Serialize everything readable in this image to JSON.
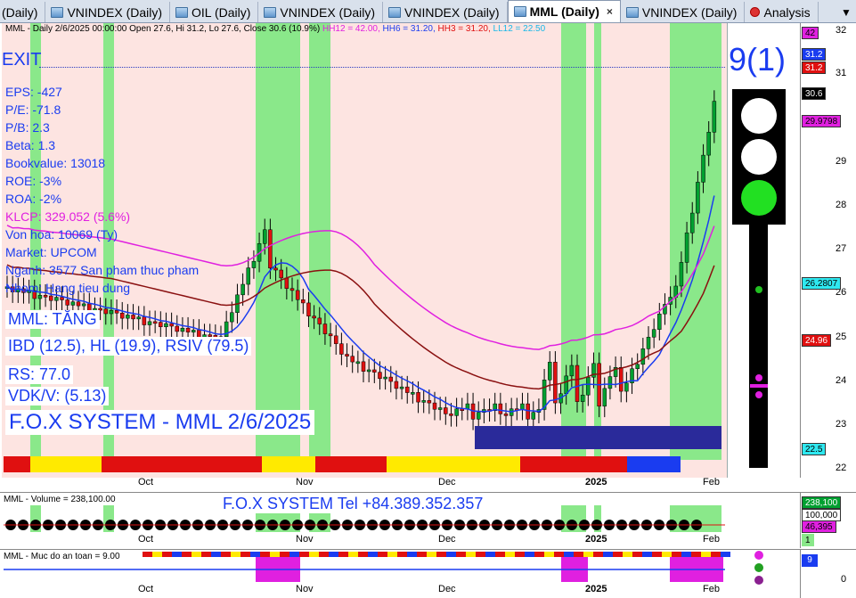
{
  "tabs": [
    {
      "label": "(Daily)",
      "active": false,
      "icon": "none"
    },
    {
      "label": "VNINDEX (Daily)",
      "active": false,
      "icon": "chart-icon"
    },
    {
      "label": "OIL (Daily)",
      "active": false,
      "icon": "chart-icon"
    },
    {
      "label": "VNINDEX (Daily)",
      "active": false,
      "icon": "chart-icon"
    },
    {
      "label": "VNINDEX (Daily)",
      "active": false,
      "icon": "chart-icon"
    },
    {
      "label": "MML (Daily)",
      "active": true,
      "icon": "chart-icon"
    },
    {
      "label": "VNINDEX (Daily)",
      "active": false,
      "icon": "chart-icon"
    },
    {
      "label": "Analysis",
      "active": false,
      "icon": "analysis-icon"
    }
  ],
  "tab_close": "×",
  "tab_scroll": "▼",
  "header": {
    "main": "MML - Daily 2/6/2025 00:00:00 Open 27.6, Hi 31.2, Lo 27.6, Close 30.6 (10.9%)",
    "hh12": "HH12 = 42.00,",
    "hh6": "HH6 = 31.20,",
    "hh3": "HH3 = 31.20,",
    "ll12": "LL12 = 22.50"
  },
  "exit_label": "EXIT",
  "fundamentals": {
    "eps": "EPS: -427",
    "pe": "P/E: -71.8",
    "pb": "P/B: 2.3",
    "beta": "Beta: 1.3",
    "bookvalue": "Bookvalue: 13018",
    "roe": "ROE: -3%",
    "roa": "ROA: -2%",
    "klcp": "KLCP: 329.052 (5.6%)",
    "vonhoa": "Von hoa: 10069 (Ty)",
    "market": "Market: UPCOM",
    "nganh": "Nganh: 3577 San pham thuc pham",
    "nhom": "Nhom: Hang tieu dung"
  },
  "trend": {
    "status": "MML: TĂNG",
    "ibd": "IBD (12.5), HL (19.9), RSIV (79.5)",
    "rs": "RS: 77.0",
    "vdk": "VDK/V:  (5.13)"
  },
  "system_title": "F.O.X SYSTEM - MML 2/6/2025",
  "signal": {
    "title": "9(1)",
    "lights": [
      "white",
      "white",
      "green"
    ]
  },
  "price_axis": {
    "ticks": [
      "32",
      "31",
      "29",
      "28",
      "27",
      "26",
      "25",
      "24",
      "23",
      "22"
    ],
    "tags": [
      {
        "text": "42",
        "bg": "#e020e0",
        "color": "#000"
      },
      {
        "text": "31.2",
        "bg": "#1a3cf0",
        "color": "#fff"
      },
      {
        "text": "31.2",
        "bg": "#e01010",
        "color": "#fff"
      },
      {
        "text": "30.6",
        "bg": "#000000",
        "color": "#fff"
      },
      {
        "text": "29.9798",
        "bg": "#e020e0",
        "color": "#000"
      },
      {
        "text": "26.2807",
        "bg": "#2ee8f0",
        "color": "#000"
      },
      {
        "text": "24.96",
        "bg": "#e01010",
        "color": "#fff"
      },
      {
        "text": "22.5",
        "bg": "#2ee8f0",
        "color": "#000"
      }
    ]
  },
  "months": [
    "Oct",
    "Nov",
    "Dec",
    "2025",
    "Feb"
  ],
  "volume": {
    "title": "MML - Volume = 238,100.00",
    "tel": "F.O.X SYSTEM Tel +84.389.352.357",
    "tags": [
      {
        "text": "238,100",
        "bg": "#00a030",
        "color": "#fff"
      },
      {
        "text": "100,000",
        "bg": "#ffffff",
        "color": "#000"
      },
      {
        "text": "46,395",
        "bg": "#e020e0",
        "color": "#000"
      }
    ],
    "extra_tag": "1"
  },
  "safety": {
    "title": "MML - Muc do an toan = 9.00",
    "tag": "9",
    "tick": "0"
  },
  "colors": {
    "plot_bg": "#fde4e1",
    "green_zone": "#8ae88a",
    "up_candle": "#00a030",
    "down_candle": "#e01010",
    "blue": "#1a3cf0",
    "magenta": "#e020e0",
    "cyan": "#2ee8f0",
    "dark_red": "#8a1010"
  }
}
